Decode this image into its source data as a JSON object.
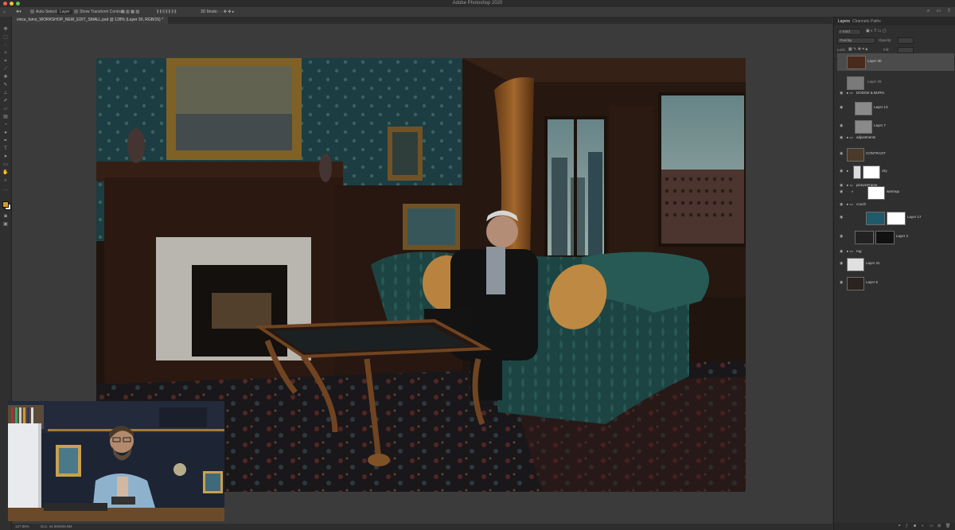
{
  "app": {
    "title": "Adobe Photoshop 2020",
    "traffic_colors": [
      "#ee5f56",
      "#f6bd3d",
      "#5ec84e"
    ]
  },
  "options_bar": {
    "auto_select_label": "Auto-Select:",
    "auto_select_value": "Layer",
    "show_transform_label": "Show Transform Controls",
    "mode_3d_label": "3D Mode:"
  },
  "document": {
    "tab_label": "vince_fumo_WORKSHOP_NEW_EDIT_SMALL.psd @ 128% (Layer 30, RGB/16) *"
  },
  "status": {
    "zoom": "127.88%",
    "doc_size": "Doc: 44.9M/826.9M"
  },
  "panel": {
    "tabs": [
      "Layers",
      "Channels",
      "Paths"
    ],
    "filter_kind": "Kind",
    "blend_mode": "Overlay",
    "opacity_label": "Opacity:",
    "lock_label": "Lock:",
    "fill_label": "Fill:",
    "layers": [
      {
        "name": "Layer 30",
        "selected": true
      },
      {
        "name": "Layer 29",
        "selected": false
      },
      {
        "name": "DODGE & BURN",
        "selected": false
      },
      {
        "name": "Layer 13",
        "selected": false
      },
      {
        "name": "Layer 7",
        "selected": false
      },
      {
        "name": "adjustments",
        "selected": false
      },
      {
        "name": "CONTRAST",
        "selected": false
      },
      {
        "name": "city",
        "selected": false
      },
      {
        "name": "pictureFrame",
        "selected": false
      },
      {
        "name": "warmup",
        "selected": false
      },
      {
        "name": "couch",
        "selected": false
      },
      {
        "name": "Layer 17",
        "selected": false
      },
      {
        "name": "Layer 2",
        "selected": false
      },
      {
        "name": "rug",
        "selected": false
      },
      {
        "name": "Layer 31",
        "selected": false
      },
      {
        "name": "Layer 6",
        "selected": false
      }
    ]
  },
  "colors": {
    "foreground": "#d89a22",
    "background": "#ffffff",
    "ui_bg": "#323232",
    "panel_bg": "#2f2f2f",
    "selected_layer": "#4b4b4b"
  },
  "icons": [
    "move-tool-icon",
    "marquee-tool-icon",
    "lasso-tool-icon",
    "crop-tool-icon",
    "brush-tool-icon",
    "eraser-tool-icon",
    "type-tool-icon",
    "hand-tool-icon",
    "zoom-tool-icon",
    "search-icon",
    "share-icon",
    "workspace-icon",
    "eye-icon",
    "folder-icon",
    "trash-icon",
    "new-layer-icon"
  ]
}
